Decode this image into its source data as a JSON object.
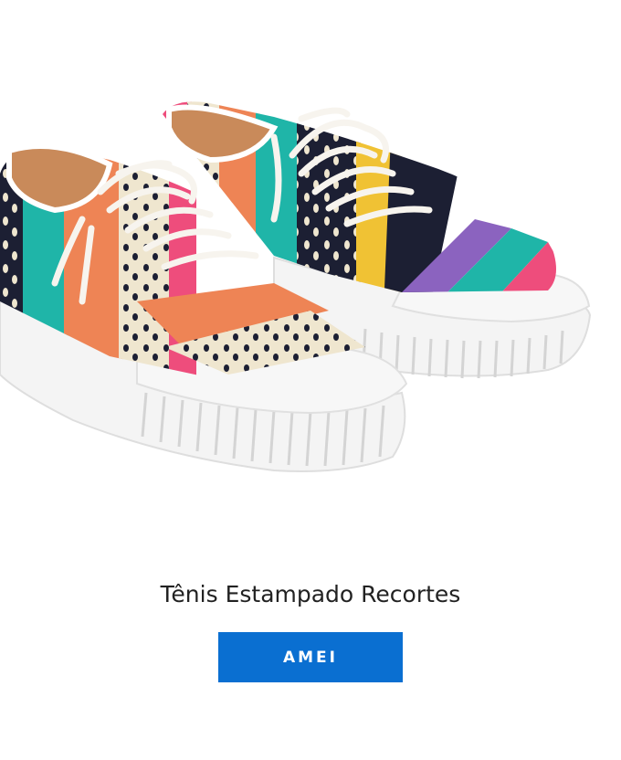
{
  "product": {
    "image_subject": "sneaker-pair",
    "title": "Tênis Estampado Recortes",
    "cta_label": "AMEI"
  },
  "colors": {
    "cta_background": "#0a6fd1",
    "cta_text": "#ffffff",
    "title_text": "#222222",
    "page_background": "#ffffff",
    "stripe_teal": "#1fb5a8",
    "stripe_orange": "#ee8455",
    "stripe_cream": "#efe6cf",
    "stripe_navy": "#1c1f33",
    "stripe_purple": "#8b63bf",
    "stripe_yellow": "#f0c234",
    "stripe_pink": "#ee4d7c"
  }
}
